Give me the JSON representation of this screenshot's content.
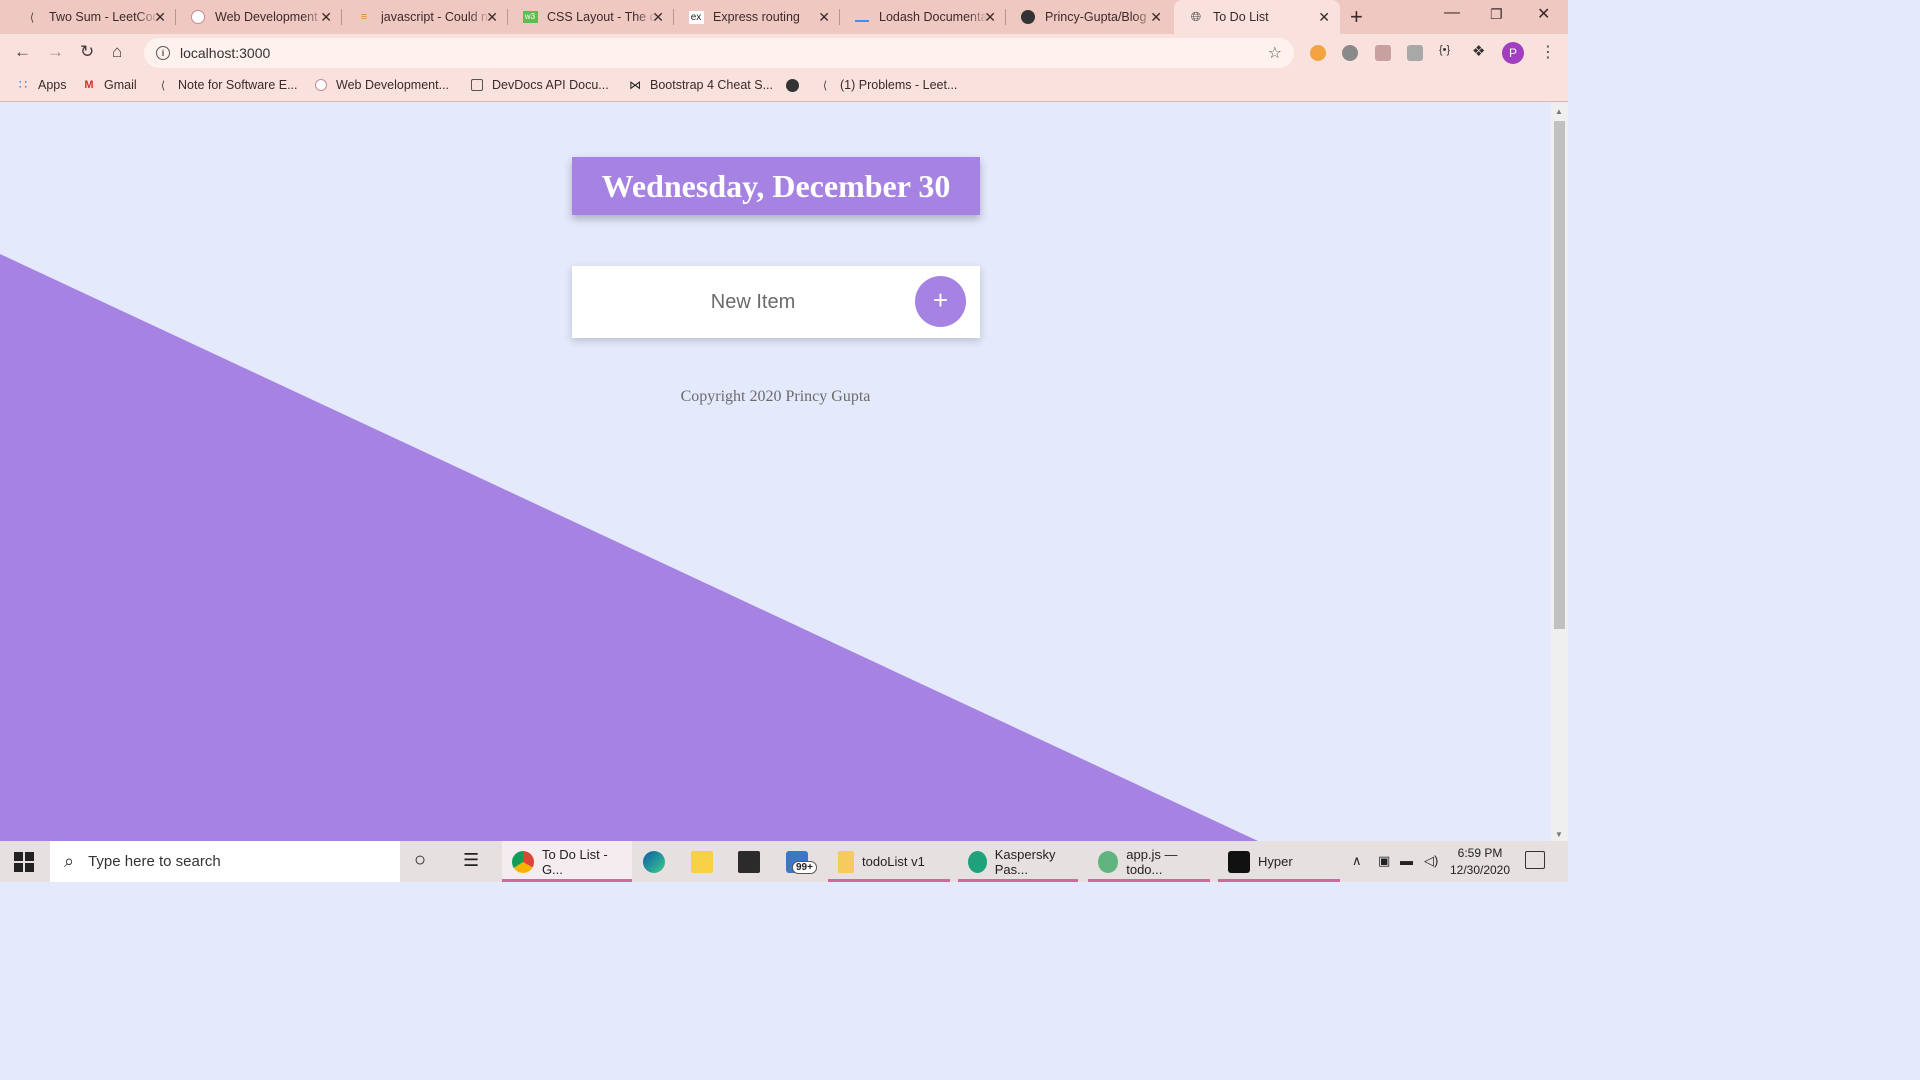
{
  "browser": {
    "tabs": [
      {
        "title": "Two Sum - LeetCode",
        "icon": "leetcode-icon",
        "active": false
      },
      {
        "title": "Web Development",
        "icon": "udemy-icon",
        "active": false
      },
      {
        "title": "javascript - Could not",
        "icon": "stackoverflow-icon",
        "active": false
      },
      {
        "title": "CSS Layout - The display",
        "icon": "w3schools-icon",
        "active": false
      },
      {
        "title": "Express routing",
        "icon": "express-icon",
        "active": false
      },
      {
        "title": "Lodash Documentation",
        "icon": "lodash-icon",
        "active": false
      },
      {
        "title": "Princy-Gupta/Blog",
        "icon": "github-icon",
        "active": false
      },
      {
        "title": "To Do List",
        "icon": "globe-icon",
        "active": true
      }
    ],
    "address": "localhost:3000",
    "bookmarks": [
      {
        "label": "Apps",
        "icon": "apps-grid-icon"
      },
      {
        "label": "Gmail",
        "icon": "gmail-icon"
      },
      {
        "label": "Note for Software E...",
        "icon": "leetcode-icon"
      },
      {
        "label": "Web Development...",
        "icon": "udemy-icon"
      },
      {
        "label": "DevDocs API Docu...",
        "icon": "devdocs-icon"
      },
      {
        "label": "Bootstrap 4 Cheat S...",
        "icon": "bowtie-icon"
      },
      {
        "label": "",
        "icon": "globe-icon"
      },
      {
        "label": "(1) Problems - Leet...",
        "icon": "leetcode-icon"
      }
    ],
    "profile_initial": "P"
  },
  "page": {
    "heading": "Wednesday, December 30",
    "new_item_placeholder": "New Item",
    "add_button_label": "+",
    "footer": "Copyright 2020 Princy Gupta",
    "colors": {
      "background": "#E4E9FC",
      "accent": "#A683E3",
      "card": "#FFFFFF"
    }
  },
  "taskbar": {
    "search_placeholder": "Type here to search",
    "apps": [
      {
        "label": "To Do List - G...",
        "icon": "chrome-icon",
        "active": true
      },
      {
        "label": "",
        "icon": "edge-icon"
      },
      {
        "label": "",
        "icon": "sticky-notes-icon"
      },
      {
        "label": "",
        "icon": "store-icon"
      },
      {
        "label": "99+",
        "icon": "mail-icon"
      },
      {
        "label": "todoList v1",
        "icon": "folder-icon"
      },
      {
        "label": "Kaspersky Pas...",
        "icon": "kaspersky-icon"
      },
      {
        "label": "app.js — todo...",
        "icon": "atom-icon"
      },
      {
        "label": "Hyper",
        "icon": "hyper-icon"
      }
    ],
    "time": "6:59 PM",
    "date": "12/30/2020"
  }
}
